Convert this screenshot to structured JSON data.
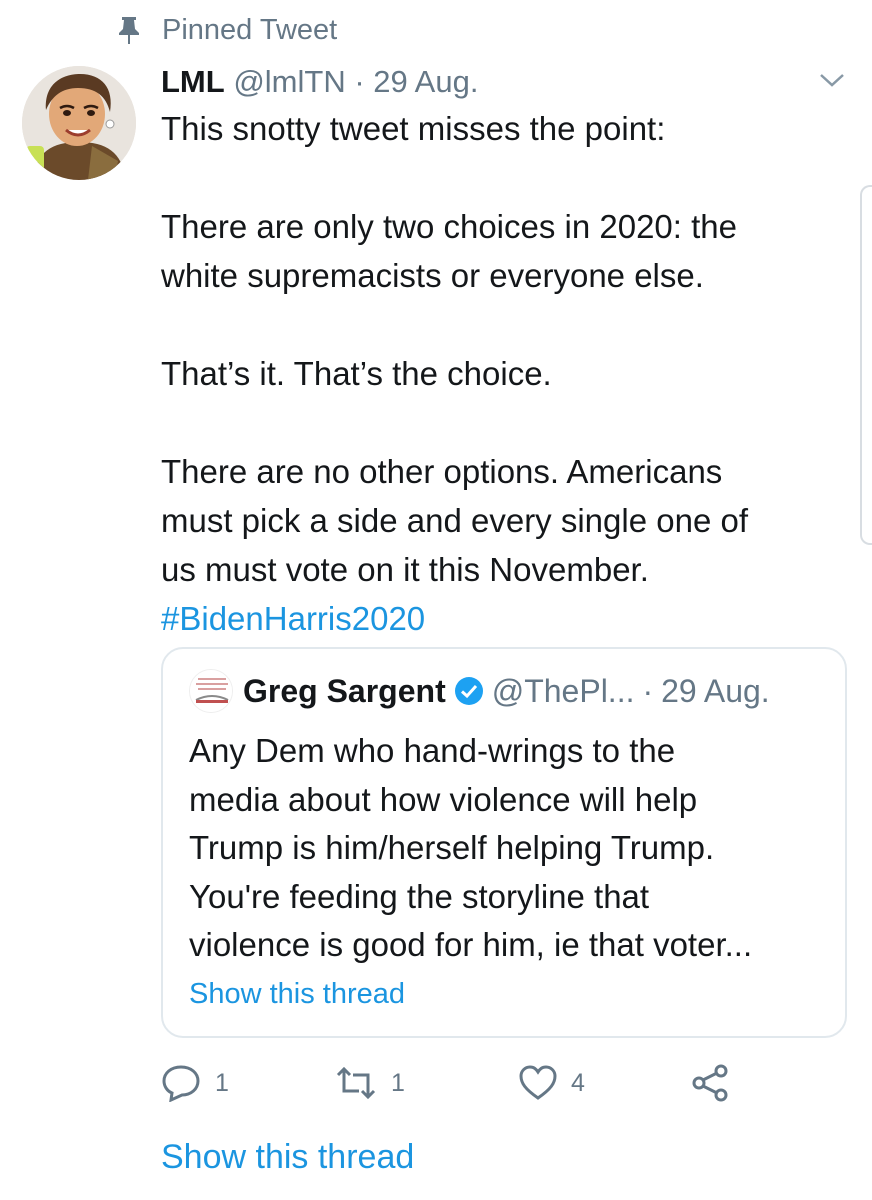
{
  "pinned": {
    "label": "Pinned Tweet",
    "icon": "pin-icon"
  },
  "tweet": {
    "name": "LML",
    "handle": "@lmlTN",
    "separator": "·",
    "date": "29 Aug.",
    "lines": [
      "This snotty tweet misses the point:",
      "",
      "There are only two choices in 2020: the",
      "white supremacists or everyone else.",
      "",
      "That’s it. That’s the choice.",
      "",
      "There are no other options. Americans",
      "must pick a side and every single one of",
      "us must vote on it this November."
    ],
    "hashtag": "#BidenHarris2020"
  },
  "quote": {
    "name": "Greg Sargent",
    "handle": "@ThePl...",
    "separator": "·",
    "date": "29 Aug.",
    "lines": [
      "Any Dem who hand-wrings to the",
      "media about how violence will help",
      "Trump is him/herself helping Trump.",
      "You're feeding the storyline that",
      "violence is good for him, ie that voter..."
    ],
    "show_thread": "Show this thread"
  },
  "actions": {
    "reply_count": "1",
    "retweet_count": "1",
    "like_count": "4"
  },
  "show_thread": "Show this thread",
  "colors": {
    "link": "#1b95e0",
    "secondary": "#657786",
    "border": "#e1e8ed"
  }
}
